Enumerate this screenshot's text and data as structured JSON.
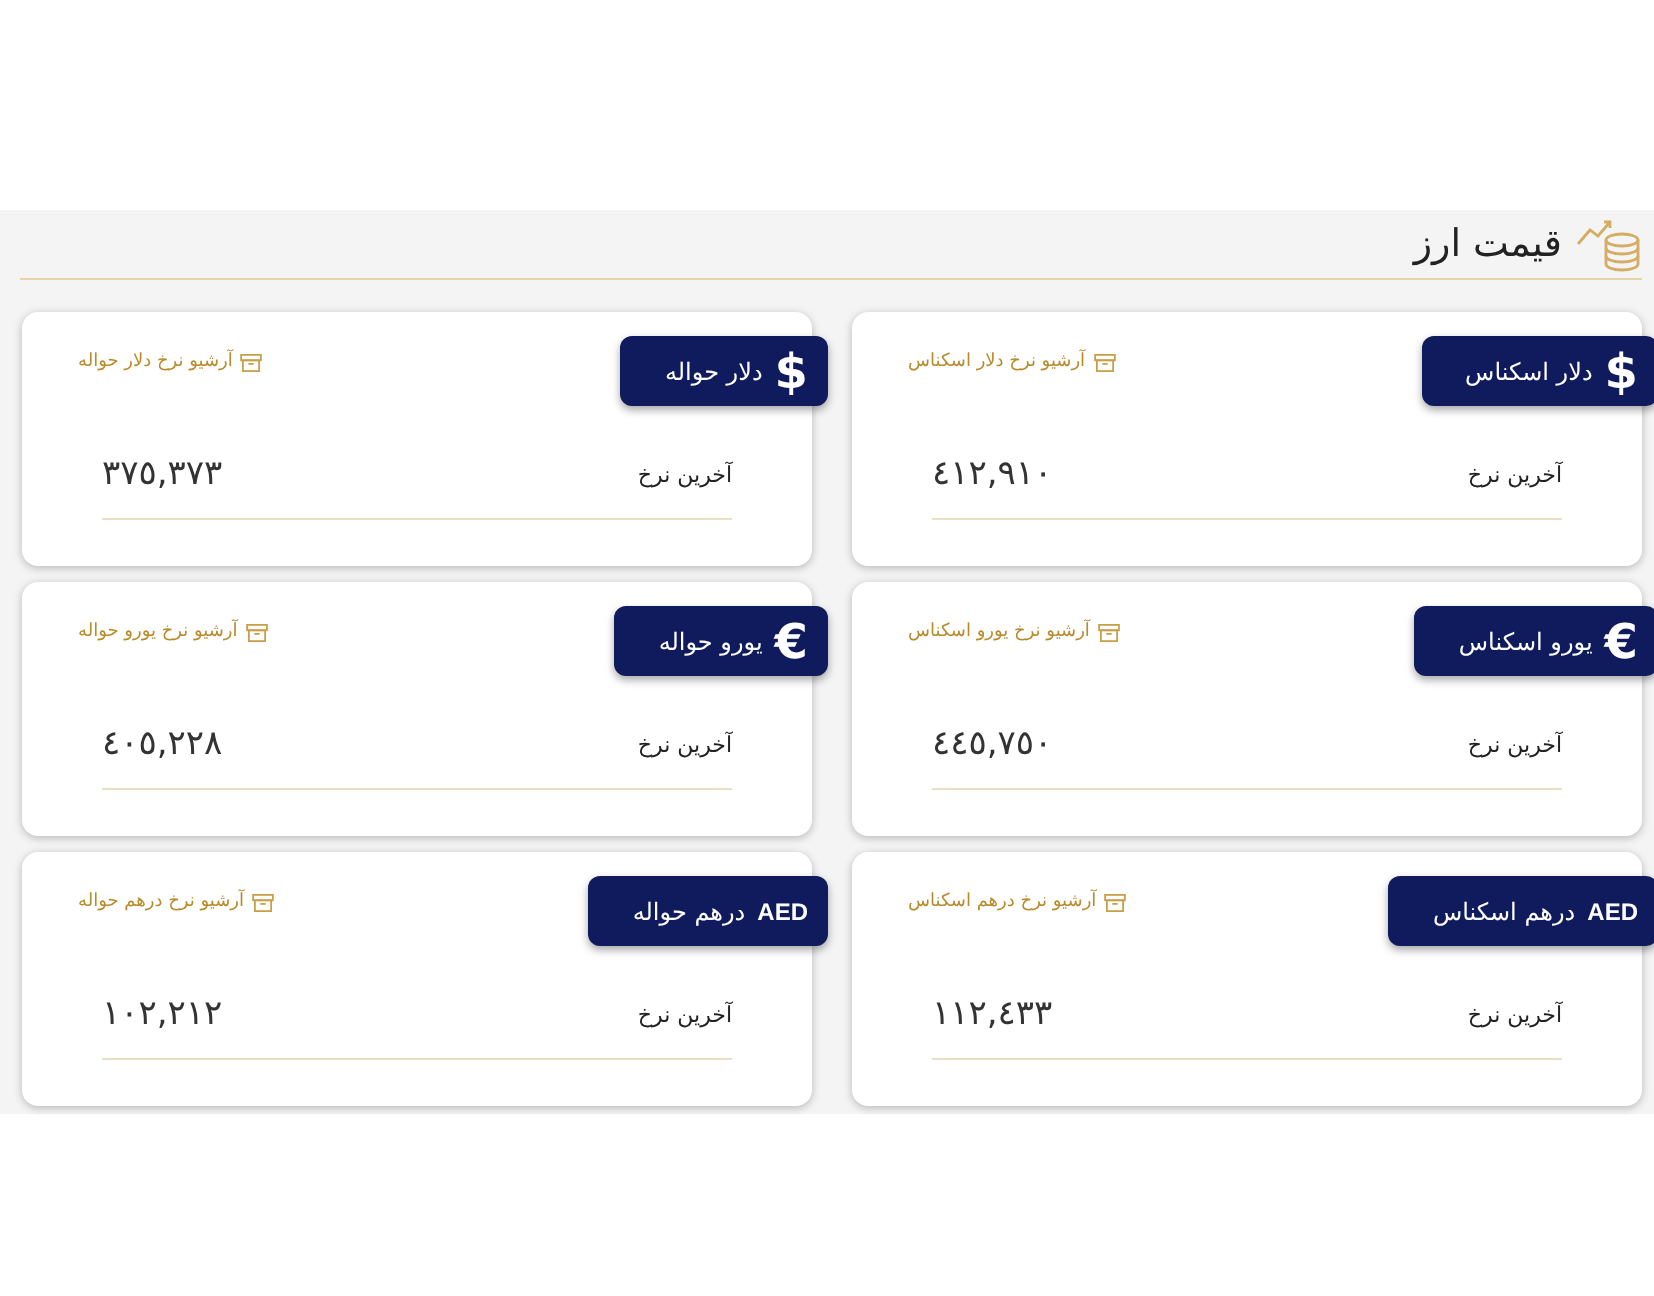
{
  "section": {
    "title": "قیمت ارز"
  },
  "cards": [
    {
      "symbol": "$",
      "kind": "glyph",
      "title": "دلار اسکناس",
      "archive": "آرشیو نرخ دلار اسکناس",
      "label": "آخرین نرخ",
      "value": "٤١٢,٩١٠"
    },
    {
      "symbol": "$",
      "kind": "glyph",
      "title": "دلار حواله",
      "archive": "آرشیو نرخ دلار حواله",
      "label": "آخرین نرخ",
      "value": "٣٧٥,٣٧٣"
    },
    {
      "symbol": "€",
      "kind": "glyph",
      "title": "یورو اسکناس",
      "archive": "آرشیو نرخ یورو اسکناس",
      "label": "آخرین نرخ",
      "value": "٤٤٥,٧٥٠"
    },
    {
      "symbol": "€",
      "kind": "glyph",
      "title": "یورو حواله",
      "archive": "آرشیو نرخ یورو حواله",
      "label": "آخرین نرخ",
      "value": "٤٠٥,٢٢٨"
    },
    {
      "symbol": "AED",
      "kind": "code",
      "title": "درهم اسکناس",
      "archive": "آرشیو نرخ درهم اسکناس",
      "label": "آخرین نرخ",
      "value": "١١٢,٤٣٣"
    },
    {
      "symbol": "AED",
      "kind": "code",
      "title": "درهم حواله",
      "archive": "آرشیو نرخ درهم حواله",
      "label": "آخرین نرخ",
      "value": "١٠٢,٢١٢"
    }
  ]
}
